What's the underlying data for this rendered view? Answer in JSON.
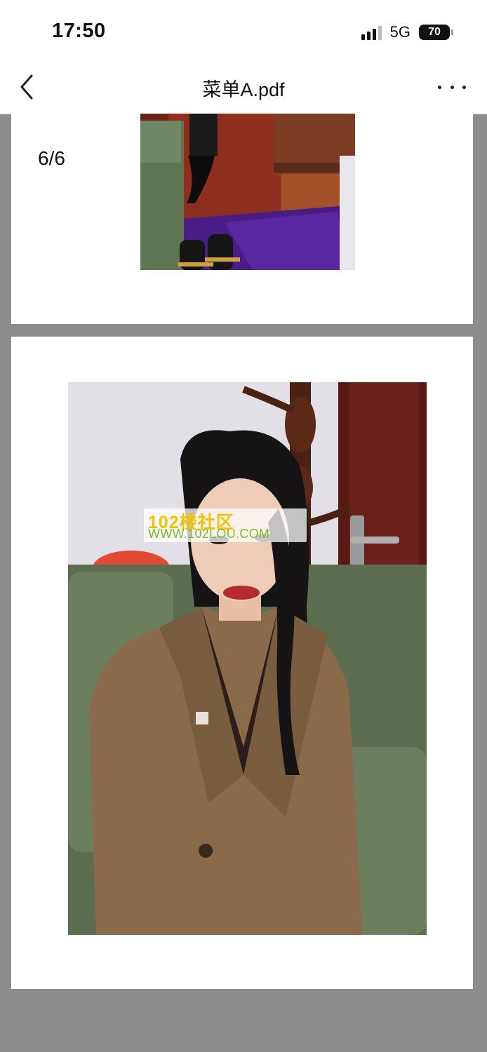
{
  "status_bar": {
    "time": "17:50",
    "network": "5G",
    "battery": "70"
  },
  "nav": {
    "title": "菜单A.pdf",
    "back_icon": "chevron-left-icon",
    "more_icon": "more-horizontal-icon"
  },
  "viewer": {
    "page_indicator": "6/6"
  },
  "watermark": {
    "line1": "102楼社区",
    "line2": "WWW.102LOU.COM"
  },
  "colors": {
    "background": "#8c8c8c",
    "page": "#ffffff",
    "watermark_yellow": "#f2c100",
    "watermark_green": "#7cbc2a"
  }
}
